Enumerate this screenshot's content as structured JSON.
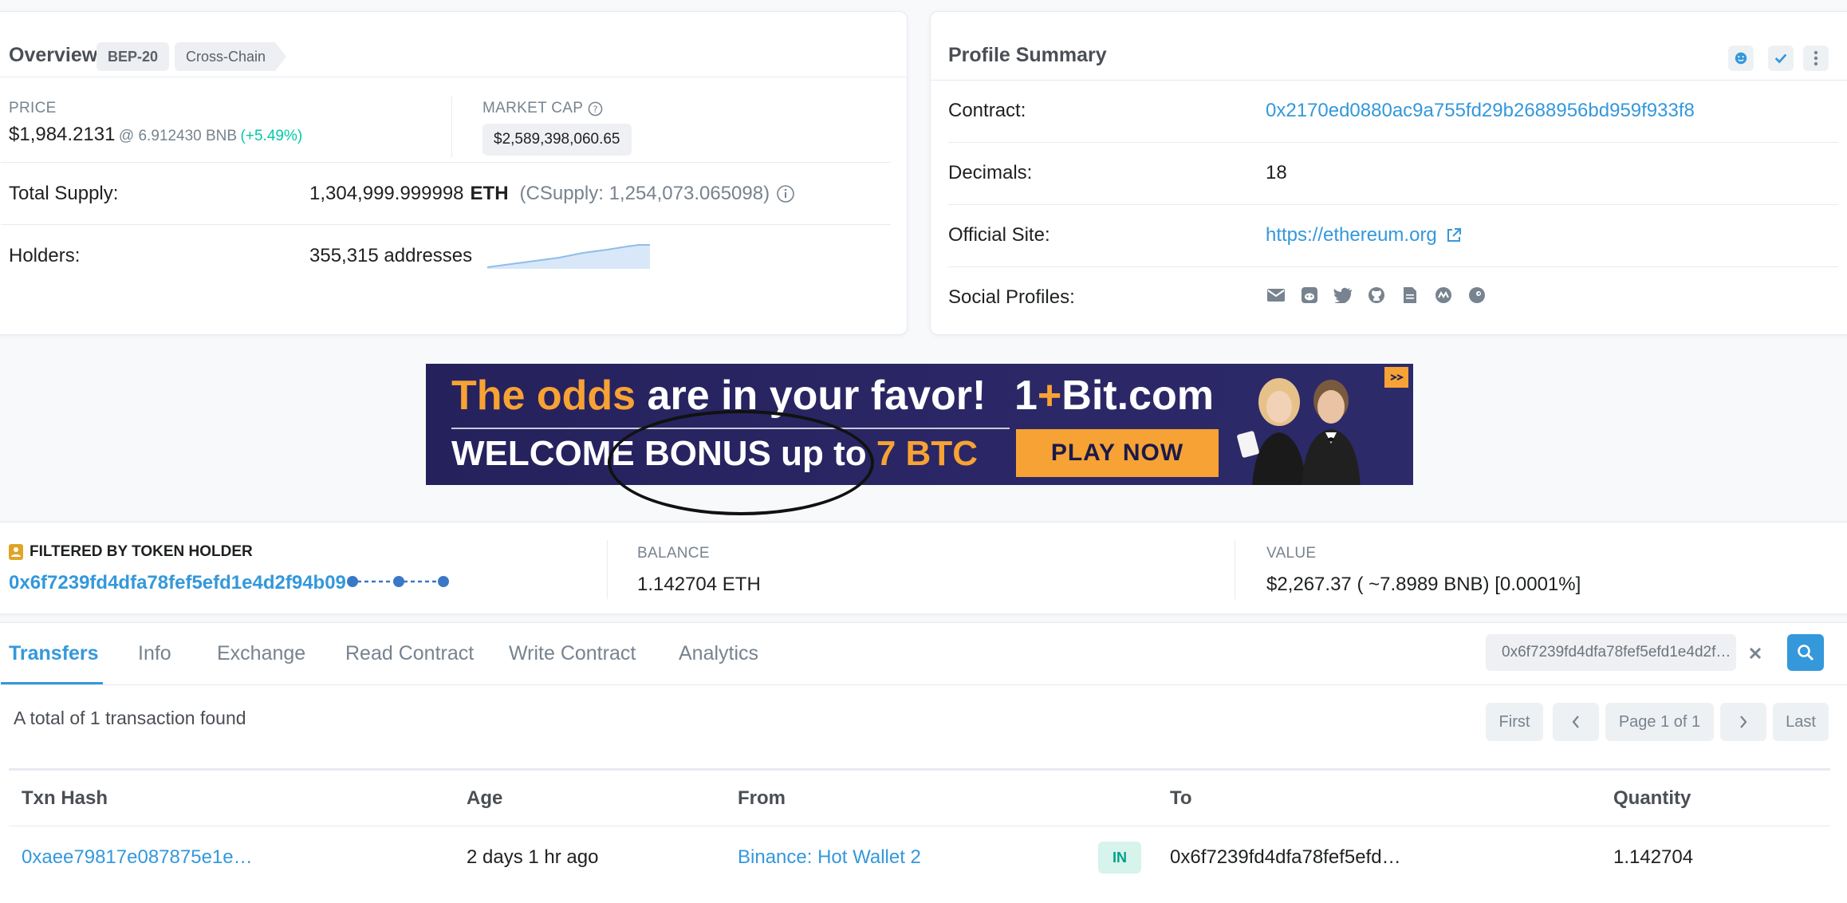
{
  "overview": {
    "title": "Overview",
    "chips": [
      "BEP-20",
      "Cross-Chain"
    ],
    "price_label": "PRICE",
    "price_value": "$1,984.2131",
    "price_bnb": "@ 6.912430 BNB",
    "price_change": "(+5.49%)",
    "market_cap_label": "MARKET CAP",
    "market_cap_value": "$2,589,398,060.65",
    "total_supply_label": "Total Supply:",
    "total_supply_value": "1,304,999.999998",
    "total_supply_unit": "ETH",
    "csupply": "(CSupply: 1,254,073.065098)",
    "holders_label": "Holders:",
    "holders_value": "355,315 addresses"
  },
  "profile": {
    "title": "Profile Summary",
    "contract_label": "Contract:",
    "contract_value": "0x2170ed0880ac9a755fd29b2688956bd959f933f8",
    "decimals_label": "Decimals:",
    "decimals_value": "18",
    "site_label": "Official Site:",
    "site_value": "https://ethereum.org",
    "social_label": "Social Profiles:",
    "social_icons": [
      "email-icon",
      "reddit-icon",
      "twitter-icon",
      "github-icon",
      "document-icon",
      "coinmarketcap-icon",
      "coingecko-icon"
    ]
  },
  "banner": {
    "line1_highlight": "The odds",
    "line1_rest": " are in your favor!",
    "line2_rest": "WELCOME BONUS up to ",
    "line2_highlight": "7 BTC",
    "brand_prefix": "1",
    "brand_plus": "+",
    "brand_rest": "Bit.com",
    "cta": "PLAY NOW"
  },
  "filtered": {
    "label": "FILTERED BY TOKEN HOLDER",
    "address": "0x6f7239fd4dfa78fef5efd1e4d2f94b09",
    "balance_label": "BALANCE",
    "balance_value": "1.142704 ETH",
    "value_label": "VALUE",
    "value_value": "$2,267.37 ( ~7.8989 BNB) [0.0001%]"
  },
  "tabs": [
    "Transfers",
    "Info",
    "Exchange",
    "Read Contract",
    "Write Contract",
    "Analytics"
  ],
  "search": {
    "value": "0x6f7239fd4dfa78fef5efd1e4d2f9..."
  },
  "summary": "A total of 1 transaction found",
  "pagination": {
    "first": "First",
    "page": "Page 1 of 1",
    "last": "Last"
  },
  "table": {
    "headers": [
      "Txn Hash",
      "Age",
      "From",
      "To",
      "Quantity"
    ],
    "rows": [
      {
        "hash": "0xaee79817e087875e1e…",
        "age": "2 days 1 hr ago",
        "from": "Binance: Hot Wallet 2",
        "direction": "IN",
        "to": "0x6f7239fd4dfa78fef5efd…",
        "quantity": "1.142704"
      }
    ]
  },
  "colors": {
    "accent": "#3498db",
    "positive": "#00c9a7",
    "banner_bg": "#25215c",
    "banner_orange": "#f7a234"
  }
}
